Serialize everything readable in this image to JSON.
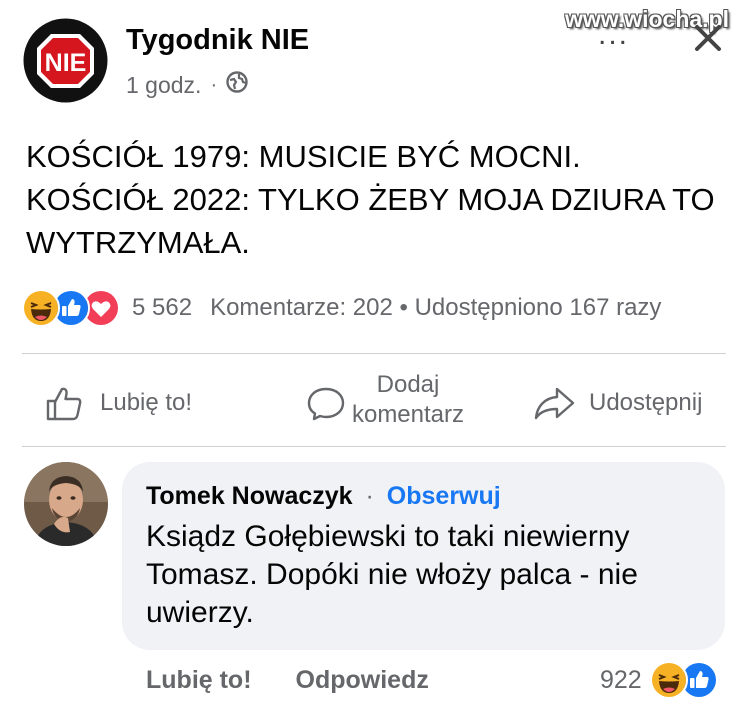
{
  "watermark": "www.wiocha.pl",
  "post": {
    "page_name": "Tygodnik NIE",
    "logo_text": "NIE",
    "time": "1 godz.",
    "separator": "·",
    "more_label": "...",
    "lines": [
      "KOŚCIÓŁ 1979: MUSICIE BYĆ MOCNI.",
      "KOŚCIÓŁ 2022: TYLKO ŻEBY MOJA DZIURA TO",
      "WYTRZYMAŁA."
    ],
    "reactions": {
      "icons": [
        "haha-icon",
        "like-icon",
        "love-icon"
      ],
      "count": "5 562",
      "comments": "Komentarze: 202",
      "dot": "•",
      "shares": "Udostępniono 167 razy"
    },
    "actions": {
      "like": "Lubię to!",
      "comment_line1": "Dodaj",
      "comment_line2": "komentarz",
      "share": "Udostępnij"
    }
  },
  "comment": {
    "author": "Tomek Nowaczyk",
    "separator": "·",
    "follow": "Obserwuj",
    "lines": [
      "Ksiądz Gołębiewski to taki niewierny",
      "Tomasz. Dopóki nie włoży palca - nie",
      "uwierzy."
    ],
    "like": "Lubię to!",
    "reply": "Odpowiedz",
    "reaction_count": "922"
  },
  "colors": {
    "brand_blue": "#1877f2",
    "logo_red": "#d6161e",
    "secondary_text": "#65676b",
    "bubble_bg": "#f0f2f5"
  }
}
